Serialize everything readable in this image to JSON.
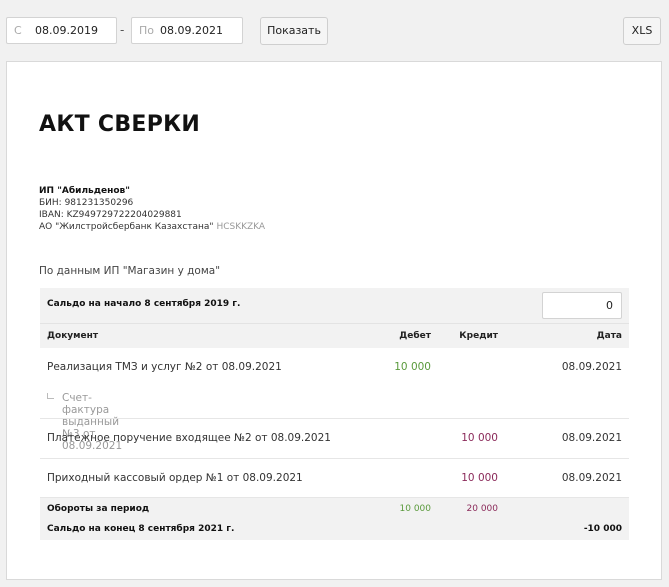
{
  "toolbar": {
    "from_prefix": "С",
    "from_value": "08.09.2019",
    "separator": "-",
    "to_prefix": "По",
    "to_value": "08.09.2021",
    "show_label": "Показать",
    "xls_label": "XLS"
  },
  "report": {
    "title": "АКТ СВЕРКИ",
    "company_name": "ИП \"Абильденов\"",
    "bin": "БИН: 981231350296",
    "iban": "IBAN: KZ949729722204029881",
    "bank": "АО \"Жилстройсбербанк Казахстана\"",
    "bank_code": "HCSKKZKA",
    "source_text": "По данным ИП \"Магазин у дома\""
  },
  "table": {
    "opening_label": "Сальдо на начало 8 сентября 2019 г.",
    "opening_value": "0",
    "headers": {
      "document": "Документ",
      "debit": "Дебет",
      "credit": "Кредит",
      "date": "Дата"
    },
    "rows": [
      {
        "document": "Реализация ТМЗ и услуг №2 от 08.09.2021",
        "debit": "10 000",
        "credit": "",
        "date": "08.09.2021",
        "sub": "Счет-фактура выданный №3 от 08.09.2021"
      },
      {
        "document": "Платежное поручение входящее №2 от 08.09.2021",
        "debit": "",
        "credit": "10 000",
        "date": "08.09.2021"
      },
      {
        "document": "Приходный кассовый ордер №1 от 08.09.2021",
        "debit": "",
        "credit": "10 000",
        "date": "08.09.2021"
      }
    ],
    "turnover_label": "Обороты за период",
    "turnover_debit": "10 000",
    "turnover_credit": "20 000",
    "closing_label": "Сальдо на конец 8 сентября 2021 г.",
    "closing_value": "-10 000"
  }
}
